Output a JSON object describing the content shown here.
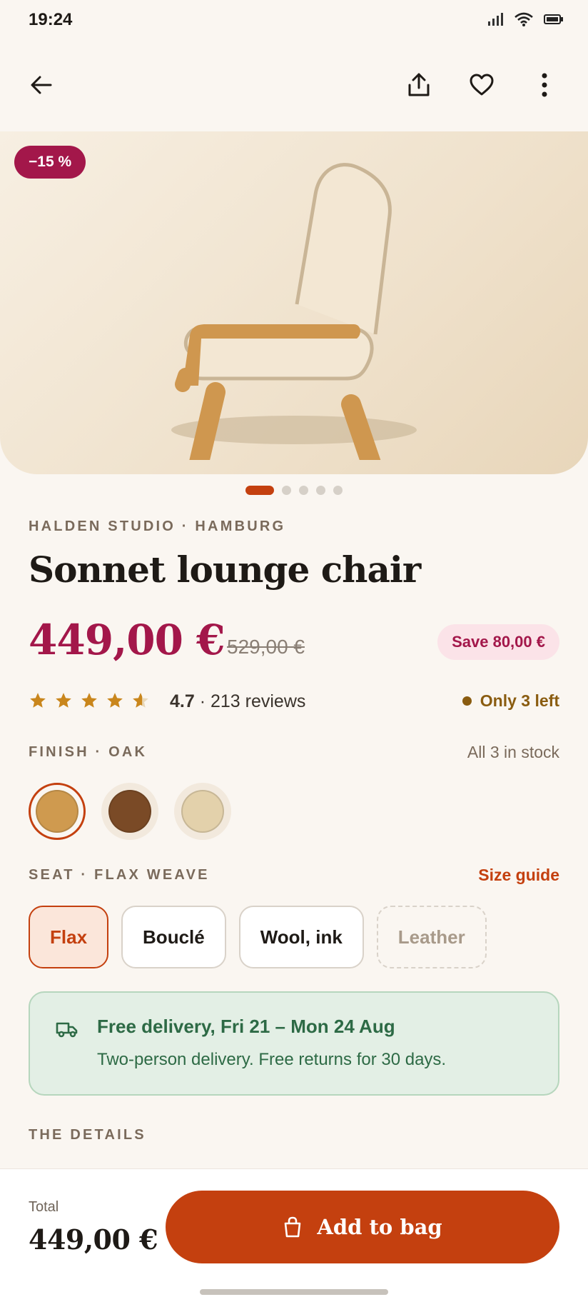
{
  "status": {
    "time": "19:24"
  },
  "product": {
    "discount_badge": "−15 %",
    "brand": "HALDEN STUDIO · HAMBURG",
    "title": "Sonnet lounge chair",
    "price": "449,00 €",
    "old_price": "529,00 €",
    "save": "Save 80,00 €",
    "rating": "4.7",
    "reviews": " · 213 reviews",
    "stock_note": "Only 3 left",
    "image_count": 5,
    "active_image": 0
  },
  "finish": {
    "label": "FINISH · OAK",
    "stock": "All 3 in stock",
    "swatches": [
      {
        "name": "oak",
        "color": "#cf9a4f",
        "selected": true
      },
      {
        "name": "walnut",
        "color": "#7a4a26",
        "selected": false
      },
      {
        "name": "ash",
        "color": "#e3d1ab",
        "selected": false
      }
    ]
  },
  "seat": {
    "label": "SEAT · FLAX WEAVE",
    "size_guide": "Size guide",
    "options": [
      {
        "label": "Flax",
        "state": "selected"
      },
      {
        "label": "Bouclé",
        "state": "normal"
      },
      {
        "label": "Wool, ink",
        "state": "normal"
      },
      {
        "label": "Leather",
        "state": "disabled"
      }
    ]
  },
  "delivery": {
    "title": "Free delivery, Fri 21 – Mon 24 Aug",
    "subtitle": "Two-person delivery. Free returns for 30 days."
  },
  "details_label": "THE DETAILS",
  "bottom": {
    "total_label": "Total",
    "total_value": "449,00 €",
    "cta": "Add to bag"
  },
  "colors": {
    "accent": "#c4400f",
    "sale": "#a3174a",
    "delivery_green": "#2d6a45"
  },
  "icons": [
    "back-arrow-icon",
    "share-icon",
    "heart-icon",
    "more-vert-icon",
    "truck-icon",
    "bag-icon",
    "star-icon"
  ]
}
